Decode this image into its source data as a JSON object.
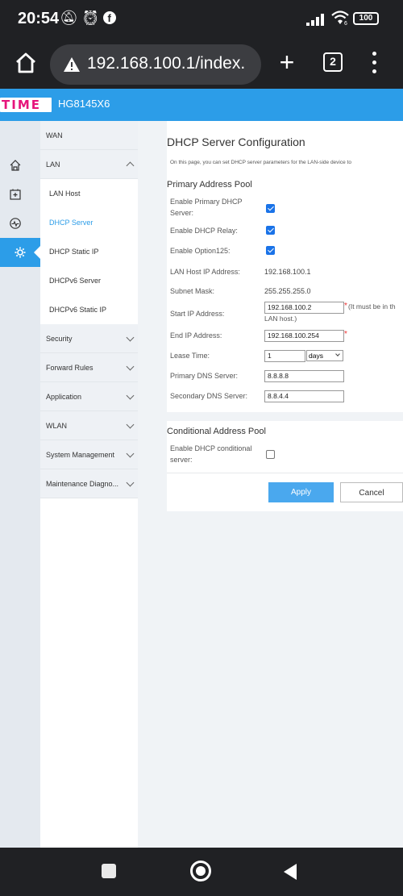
{
  "status_bar": {
    "time": "20:54",
    "left_icons": [
      "no-bell-icon",
      "alarm-icon",
      "facebook-icon"
    ],
    "right_icons": [
      "signal-icon",
      "wifi6-icon",
      "battery-icon"
    ],
    "wifi_badge": "6",
    "battery": "100"
  },
  "browser": {
    "url": "192.168.100.1/index.",
    "tab_count": "2"
  },
  "router": {
    "brand": "TIME",
    "model": "HG8145X6"
  },
  "rail": {
    "items": [
      {
        "icon": "home-icon",
        "active": false
      },
      {
        "icon": "add-box-icon",
        "active": false
      },
      {
        "icon": "pulse-icon",
        "active": false
      },
      {
        "icon": "gear-icon",
        "active": true
      }
    ]
  },
  "subnav": {
    "wan": "WAN",
    "lan": "LAN",
    "lan_host": "LAN Host",
    "dhcp_server": "DHCP Server",
    "dhcp_static_ip": "DHCP Static IP",
    "dhcpv6_server": "DHCPv6 Server",
    "dhcpv6_static_ip": "DHCPv6 Static IP",
    "security": "Security",
    "forward_rules": "Forward Rules",
    "application": "Application",
    "wlan": "WLAN",
    "system_management": "System Management",
    "maintenance": "Maintenance Diagno..."
  },
  "page": {
    "title": "DHCP Server Configuration",
    "description": "On this page, you can set DHCP server parameters for the LAN-side device to"
  },
  "primary_pool": {
    "title": "Primary Address Pool",
    "enable_primary_dhcp_label": "Enable Primary DHCP Server:",
    "enable_primary_dhcp": true,
    "enable_dhcp_relay_label": "Enable DHCP Relay:",
    "enable_dhcp_relay": true,
    "enable_option125_label": "Enable Option125:",
    "enable_option125": true,
    "lan_host_ip_label": "LAN Host IP Address:",
    "lan_host_ip": "192.168.100.1",
    "subnet_mask_label": "Subnet Mask:",
    "subnet_mask": "255.255.255.0",
    "start_ip_label": "Start IP Address:",
    "start_ip": "192.168.100.2",
    "start_ip_hint_1": "(It must be in th",
    "start_ip_hint_2": "LAN host.)",
    "end_ip_label": "End IP Address:",
    "end_ip": "192.168.100.254",
    "required_mark": "*",
    "lease_time_label": "Lease Time:",
    "lease_time": "1",
    "lease_unit": "days",
    "primary_dns_label": "Primary DNS Server:",
    "primary_dns": "8.8.8.8",
    "secondary_dns_label": "Secondary DNS Server:",
    "secondary_dns": "8.8.4.4"
  },
  "conditional_pool": {
    "title": "Conditional Address Pool",
    "enable_conditional_label": "Enable DHCP conditional server:",
    "enable_conditional": false
  },
  "actions": {
    "apply": "Apply",
    "cancel": "Cancel"
  },
  "colors": {
    "accent": "#2c9de8",
    "brand_pink": "#e6157b",
    "checkbox": "#1a73e8",
    "apply_button": "#4aa8ee",
    "required": "#ee3333"
  }
}
